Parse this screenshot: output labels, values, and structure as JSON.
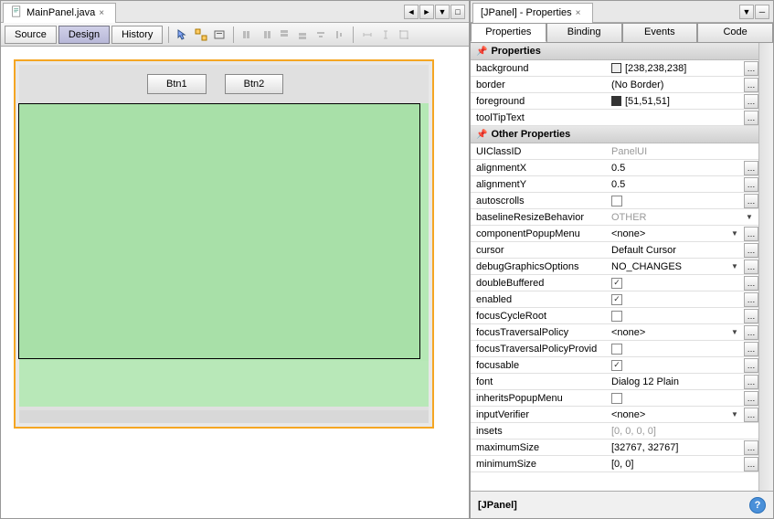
{
  "editor": {
    "tab_title": "MainPanel.java",
    "view_tabs": {
      "source": "Source",
      "design": "Design",
      "history": "History"
    },
    "buttons": {
      "btn1": "Btn1",
      "btn2": "Btn2"
    }
  },
  "properties_panel": {
    "tab_title": "[JPanel] - Properties",
    "tabs": {
      "properties": "Properties",
      "binding": "Binding",
      "events": "Events",
      "code": "Code"
    },
    "section_main": "Properties",
    "section_other": "Other Properties",
    "footer_label": "[JPanel]",
    "rows_main": [
      {
        "name": "background",
        "value": "[238,238,238]",
        "swatch": "#eeeeee",
        "ellipsis": true
      },
      {
        "name": "border",
        "value": "(No Border)",
        "ellipsis": true
      },
      {
        "name": "foreground",
        "value": "[51,51,51]",
        "swatch": "#333333",
        "ellipsis": true
      },
      {
        "name": "toolTipText",
        "value": "",
        "ellipsis": true
      }
    ],
    "rows_other": [
      {
        "name": "UIClassID",
        "value": "PanelUI",
        "disabled": true
      },
      {
        "name": "alignmentX",
        "value": "0.5",
        "ellipsis": true
      },
      {
        "name": "alignmentY",
        "value": "0.5",
        "ellipsis": true
      },
      {
        "name": "autoscrolls",
        "value": "",
        "checkbox": false,
        "ellipsis": true
      },
      {
        "name": "baselineResizeBehavior",
        "value": "OTHER",
        "disabled": true,
        "dropdown": true
      },
      {
        "name": "componentPopupMenu",
        "value": "<none>",
        "dropdown": true,
        "ellipsis": true
      },
      {
        "name": "cursor",
        "value": "Default Cursor",
        "ellipsis": true
      },
      {
        "name": "debugGraphicsOptions",
        "value": "NO_CHANGES",
        "dropdown": true,
        "ellipsis": true
      },
      {
        "name": "doubleBuffered",
        "value": "",
        "checkbox": true,
        "ellipsis": true
      },
      {
        "name": "enabled",
        "value": "",
        "checkbox": true,
        "ellipsis": true
      },
      {
        "name": "focusCycleRoot",
        "value": "",
        "checkbox": false,
        "ellipsis": true
      },
      {
        "name": "focusTraversalPolicy",
        "value": "<none>",
        "dropdown": true,
        "ellipsis": true
      },
      {
        "name": "focusTraversalPolicyProvid",
        "value": "",
        "checkbox": false,
        "ellipsis": true
      },
      {
        "name": "focusable",
        "value": "",
        "checkbox": true,
        "ellipsis": true
      },
      {
        "name": "font",
        "value": "Dialog 12 Plain",
        "ellipsis": true
      },
      {
        "name": "inheritsPopupMenu",
        "value": "",
        "checkbox": false,
        "ellipsis": true
      },
      {
        "name": "inputVerifier",
        "value": "<none>",
        "dropdown": true,
        "ellipsis": true
      },
      {
        "name": "insets",
        "value": "[0, 0, 0, 0]",
        "disabled": true
      },
      {
        "name": "maximumSize",
        "value": "[32767, 32767]",
        "ellipsis": true
      },
      {
        "name": "minimumSize",
        "value": "[0, 0]",
        "ellipsis": true
      }
    ]
  }
}
